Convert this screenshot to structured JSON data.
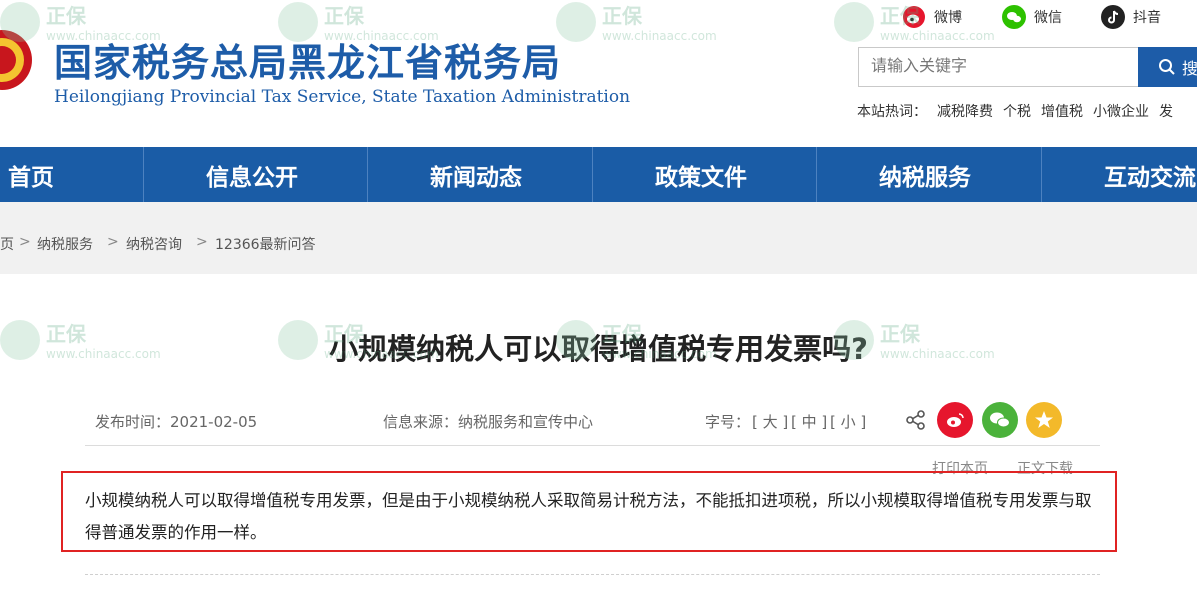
{
  "header": {
    "title": "国家税务总局黑龙江省税务局",
    "subtitle": "Heilongjiang Provincial Tax Service, State Taxation Administration",
    "social": [
      {
        "label": "微博",
        "icon": "weibo-icon",
        "color": "#e6162d"
      },
      {
        "label": "微信",
        "icon": "wechat-icon",
        "color": "#2dc100"
      },
      {
        "label": "抖音",
        "icon": "douyin-icon",
        "color": "#222222"
      }
    ],
    "search": {
      "placeholder": "请输入关键字",
      "button_label": "搜"
    },
    "hot": {
      "label": "本站热词：",
      "words": [
        "减税降费",
        "个税",
        "增值税",
        "小微企业",
        "发"
      ]
    }
  },
  "nav": {
    "items": [
      "首页",
      "信息公开",
      "新闻动态",
      "政策文件",
      "纳税服务",
      "互动交流"
    ]
  },
  "breadcrumb": {
    "items": [
      "页",
      "纳税服务",
      "纳税咨询",
      "12366最新问答"
    ],
    "separator": ">"
  },
  "article": {
    "title": "小规模纳税人可以取得增值税专用发票吗?",
    "publish": "发布时间：2021-02-05",
    "source": "信息来源：纳税服务和宣传中心",
    "fontsize_label": "字号：",
    "font_sizes": [
      "[ 大 ]",
      "[ 中 ]",
      "[ 小 ]"
    ],
    "share_icons": [
      "share-icon",
      "weibo-icon",
      "wechat-icon",
      "qzone-icon"
    ],
    "print_label": "打印本页",
    "download_label": "正文下载",
    "body": "小规模纳税人可以取得增值税专用发票，但是由于小规模纳税人采取简易计税方法，不能抵扣进项税，所以小规模取得增值税专用发票与取得普通发票的作用一样。"
  },
  "colors": {
    "brand_blue": "#1d5ca8",
    "nav_blue": "#1a5ca6",
    "highlight_red": "#e02323"
  }
}
